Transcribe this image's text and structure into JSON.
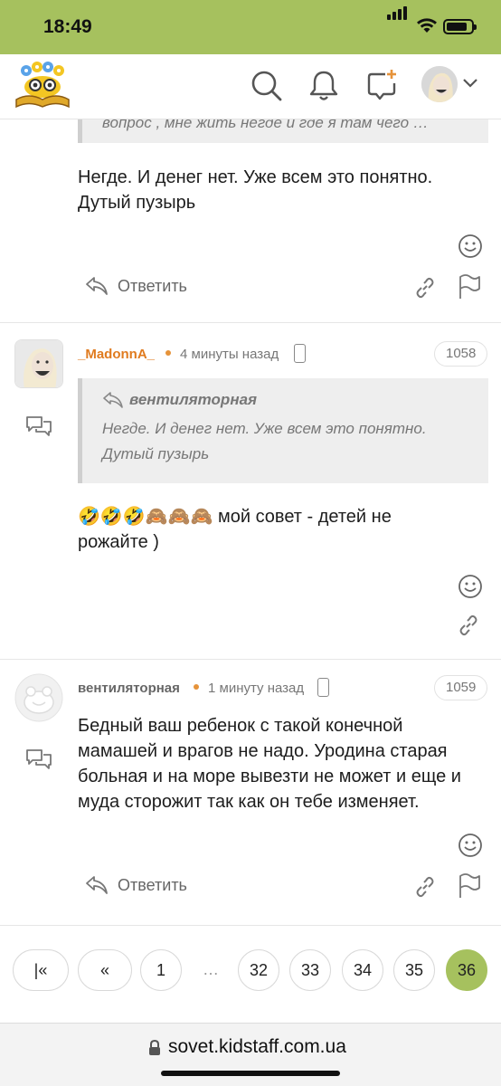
{
  "status_bar": {
    "time": "18:49"
  },
  "browser": {
    "url": "sovet.kidstaff.com.ua"
  },
  "header": {
    "brand_color": "#a6c15e"
  },
  "previous_comment": {
    "quote_preview": "вопрос , мне жить негде и где я там чего …",
    "text_lines": [
      "Негде. И денег нет. Уже всем это понятно.",
      "Дутый пузырь"
    ],
    "reply_label": "Ответить"
  },
  "comments": [
    {
      "author": "_MadonnA_",
      "author_color": "#e07b1f",
      "time": "4 минуты назад",
      "number": "1058",
      "quote": {
        "author": "вентиляторная",
        "lines": [
          "Негде. И денег нет. Уже всем это понятно.",
          "Дутый пузырь"
        ]
      },
      "emoji": "🤣🤣🤣🙈🙈🙈",
      "text_first": "мой совет - детей не",
      "text_second": "рожайте )"
    },
    {
      "author": "вентиляторная",
      "author_color": "#666666",
      "time": "1 минуту назад",
      "number": "1059",
      "text_lines": [
        "Бедный ваш ребенок с такой конечной",
        "мамашей и врагов не надо. Уродина старая",
        "больная и на море вывезти не может и еще и",
        "муда сторожит так как он тебе изменяет."
      ],
      "reply_label": "Ответить"
    }
  ],
  "pagination": {
    "first": "|«",
    "prev": "«",
    "pages": [
      "1",
      "…",
      "32",
      "33",
      "34",
      "35",
      "36"
    ],
    "active": "36"
  }
}
